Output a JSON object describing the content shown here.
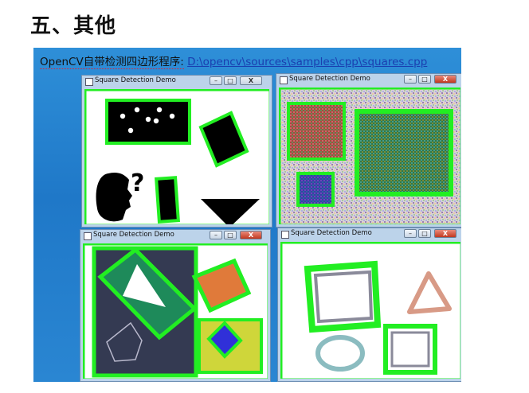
{
  "heading": "五、其他",
  "caption": {
    "label": "OpenCV自带检测四边形程序:",
    "path": "D:\\opencv\\sources\\samples\\cpp\\squares.cpp"
  },
  "windows": [
    {
      "title": "Square Detection Demo",
      "min": "–",
      "max": "□",
      "close": "X"
    },
    {
      "title": "Square Detection Demo",
      "min": "–",
      "max": "□",
      "close": "X"
    },
    {
      "title": "Square Detection Demo",
      "min": "–",
      "max": "□",
      "close": "X"
    },
    {
      "title": "Square Detection Demo",
      "min": "–",
      "max": "□",
      "close": "X"
    }
  ],
  "glyphs": {
    "question_mark": "?"
  },
  "colors": {
    "detection_green": "#22ee22",
    "desktop_blue": "#2a86d2",
    "orange": "#e07a3a",
    "teal": "#1e8a5a",
    "blue": "#3030d8",
    "yellow_green": "#cfd63a",
    "dark_slate": "#343a52",
    "salmon": "#d89a86",
    "light_teal": "#8bbcc0"
  }
}
